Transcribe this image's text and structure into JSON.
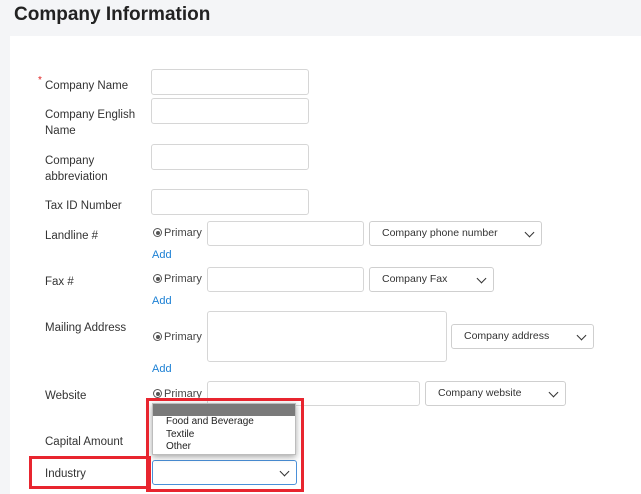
{
  "page": {
    "title": "Company Information"
  },
  "required_mark": "*",
  "fields": {
    "company_name": {
      "label": "Company Name",
      "value": ""
    },
    "company_english_name": {
      "label_line1": "Company English",
      "label_line2": "Name",
      "value": ""
    },
    "company_abbreviation": {
      "label_line1": "Company",
      "label_line2": "abbreviation",
      "value": ""
    },
    "tax_id": {
      "label": "Tax ID Number",
      "value": ""
    },
    "landline": {
      "label": "Landline #",
      "radio": "Primary",
      "value": "",
      "select": "Company phone number",
      "add": "Add"
    },
    "fax": {
      "label": "Fax #",
      "radio": "Primary",
      "value": "",
      "select": "Company Fax",
      "add": "Add"
    },
    "mailing_address": {
      "label": "Mailing Address",
      "radio": "Primary",
      "value": "",
      "select": "Company address",
      "add": "Add"
    },
    "website": {
      "label": "Website",
      "radio": "Primary",
      "value": "",
      "select": "Company website"
    },
    "capital_amount": {
      "label": "Capital Amount"
    },
    "industry": {
      "label": "Industry",
      "value": "",
      "options": [
        "Food and Beverage",
        "Textile",
        "Other"
      ]
    }
  },
  "colors": {
    "highlight": "#e8252f",
    "link": "#1a7fd4",
    "focus": "#4a90d9"
  }
}
